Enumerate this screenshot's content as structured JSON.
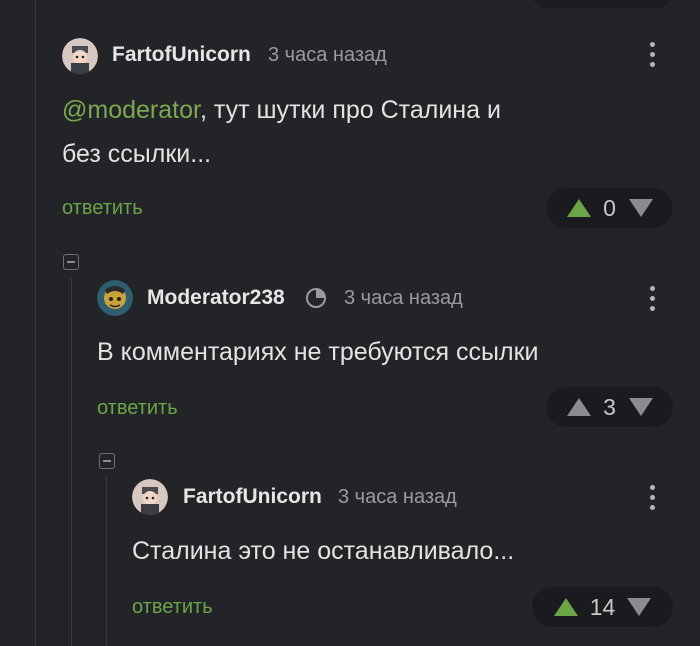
{
  "comments": [
    {
      "username": "FartofUnicorn",
      "time": "3 часа назад",
      "mention": "@moderator",
      "text_after_mention": ", тут шутки про Сталина и",
      "text_line2": "без ссылки...",
      "reply_label": "ответить",
      "score": "0"
    },
    {
      "username": "Moderator238",
      "time": "3 часа назад",
      "text": "В комментариях не требуются ссылки",
      "reply_label": "ответить",
      "score": "3"
    },
    {
      "username": "FartofUnicorn",
      "time": "3 часа назад",
      "text": "Сталина это не останавливало...",
      "reply_label": "ответить",
      "score": "14"
    }
  ],
  "colors": {
    "background": "#232427",
    "accent_green": "#6aa548",
    "muted": "#9a9b9f"
  },
  "icons": [
    "avatar-unicorn-icon",
    "avatar-moderator-icon",
    "moderator-badge-icon",
    "kebab-menu-icon",
    "upvote-arrow-icon",
    "downvote-arrow-icon",
    "collapse-thread-icon"
  ]
}
